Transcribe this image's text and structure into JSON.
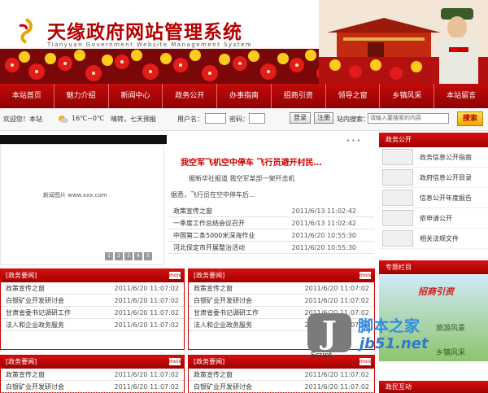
{
  "header": {
    "title": "天缘政府网站管理系统",
    "subtitle": "Tianyuan Government Website Management System"
  },
  "nav": {
    "items": [
      "本站首页",
      "魅力介绍",
      "新闻中心",
      "政务公开",
      "办事指南",
      "招商引资",
      "领导之窗",
      "乡镇风采",
      "本站留言"
    ]
  },
  "infobar": {
    "welcome": "欢迎您！本站",
    "weather": "16℃~0℃",
    "weather_desc": "晴转，七天预报",
    "user_label": "用户名：",
    "pass_label": "密码：",
    "login_button": "登录",
    "reg_button": "注册",
    "search_label": "站内搜索：",
    "search_placeholder": "请输入要搜索的内容",
    "search_button": "搜索"
  },
  "slideshow": {
    "caption": "新闻图片 www.xxx.com",
    "pages": [
      "1",
      "2",
      "3",
      "4",
      "5"
    ]
  },
  "headline": {
    "title": "我空军飞机空中停车 飞行员避开村民…",
    "sub": "据新华社报道 我空军某部一架歼击机",
    "sub2": "据悉，飞行员在空中停车后…"
  },
  "top_news": [
    {
      "title": "政策宣传之窗",
      "date": "2011/6/13 11:02:42"
    },
    {
      "title": "一季度工作总结会议召开",
      "date": "2011/6/13 11:02:42"
    },
    {
      "title": "中国第二条5000米深海作业",
      "date": "2011/6/20 10:55:30"
    },
    {
      "title": "河北保定市开展整治活动",
      "date": "2011/6/20 10:55:30"
    }
  ],
  "boxes": [
    {
      "title": "[政务要闻]",
      "more": "more",
      "rows": [
        {
          "title": "政策宣传之窗",
          "date": "2011/6/20 11:07:02"
        },
        {
          "title": "白银矿业开发研讨会",
          "date": "2011/6/20 11:07:02"
        },
        {
          "title": "甘肃省委书记调研工作",
          "date": "2011/6/20 11:07:02"
        },
        {
          "title": "法人和企业政务服务",
          "date": "2011/6/20 11:07:02"
        }
      ]
    },
    {
      "title": "[政务要闻]",
      "more": "more",
      "rows": [
        {
          "title": "政策宣传之窗",
          "date": "2011/6/20 11:07:02"
        },
        {
          "title": "白银矿业开发研讨会",
          "date": "2011/6/20 11:07:02"
        },
        {
          "title": "甘肃省委书记调研工作",
          "date": "2011/6/20 11:07:02"
        },
        {
          "title": "法人和企业政务服务",
          "date": "2011/6/20 11:07:02"
        }
      ]
    },
    {
      "title": "[政务要闻]",
      "more": "more",
      "rows": [
        {
          "title": "政策宣传之窗",
          "date": "2011/6/20 11:07:02"
        },
        {
          "title": "白银矿业开发研讨会",
          "date": "2011/6/20 11:07:02"
        }
      ]
    },
    {
      "title": "[政务要闻]",
      "more": "more",
      "rows": [
        {
          "title": "政策宣传之窗",
          "date": "2011/6/20 11:07:02"
        },
        {
          "title": "白银矿业开发研讨会",
          "date": "2011/6/20 11:07:02"
        }
      ]
    }
  ],
  "sidebar": {
    "head": "政务公开",
    "items": [
      "政务信息公开指南",
      "政府信息公开目录",
      "信息公开年度报告",
      "依申请公开",
      "相关法规文件"
    ],
    "head2": "专题栏目",
    "promo_title": "招商引资",
    "promo_sub": "旅游风景",
    "promo_sub2": "乡镇风采",
    "head3": "政民互动"
  },
  "watermark": {
    "letter": "J",
    "script": "Script",
    "cn": "脚本之家",
    "url": "jb51.net"
  },
  "colors": {
    "brand_red": "#b40000",
    "nav_red": "#c40a0a",
    "search_yellow": "#f0a800"
  }
}
